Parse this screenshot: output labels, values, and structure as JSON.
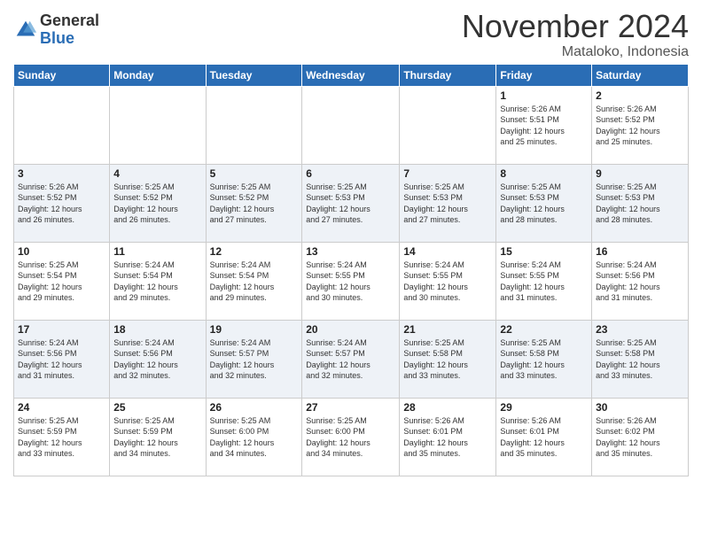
{
  "header": {
    "logo_general": "General",
    "logo_blue": "Blue",
    "month_title": "November 2024",
    "location": "Mataloko, Indonesia"
  },
  "weekdays": [
    "Sunday",
    "Monday",
    "Tuesday",
    "Wednesday",
    "Thursday",
    "Friday",
    "Saturday"
  ],
  "weeks": [
    [
      {
        "day": "",
        "info": ""
      },
      {
        "day": "",
        "info": ""
      },
      {
        "day": "",
        "info": ""
      },
      {
        "day": "",
        "info": ""
      },
      {
        "day": "",
        "info": ""
      },
      {
        "day": "1",
        "info": "Sunrise: 5:26 AM\nSunset: 5:51 PM\nDaylight: 12 hours\nand 25 minutes."
      },
      {
        "day": "2",
        "info": "Sunrise: 5:26 AM\nSunset: 5:52 PM\nDaylight: 12 hours\nand 25 minutes."
      }
    ],
    [
      {
        "day": "3",
        "info": "Sunrise: 5:26 AM\nSunset: 5:52 PM\nDaylight: 12 hours\nand 26 minutes."
      },
      {
        "day": "4",
        "info": "Sunrise: 5:25 AM\nSunset: 5:52 PM\nDaylight: 12 hours\nand 26 minutes."
      },
      {
        "day": "5",
        "info": "Sunrise: 5:25 AM\nSunset: 5:52 PM\nDaylight: 12 hours\nand 27 minutes."
      },
      {
        "day": "6",
        "info": "Sunrise: 5:25 AM\nSunset: 5:53 PM\nDaylight: 12 hours\nand 27 minutes."
      },
      {
        "day": "7",
        "info": "Sunrise: 5:25 AM\nSunset: 5:53 PM\nDaylight: 12 hours\nand 27 minutes."
      },
      {
        "day": "8",
        "info": "Sunrise: 5:25 AM\nSunset: 5:53 PM\nDaylight: 12 hours\nand 28 minutes."
      },
      {
        "day": "9",
        "info": "Sunrise: 5:25 AM\nSunset: 5:53 PM\nDaylight: 12 hours\nand 28 minutes."
      }
    ],
    [
      {
        "day": "10",
        "info": "Sunrise: 5:25 AM\nSunset: 5:54 PM\nDaylight: 12 hours\nand 29 minutes."
      },
      {
        "day": "11",
        "info": "Sunrise: 5:24 AM\nSunset: 5:54 PM\nDaylight: 12 hours\nand 29 minutes."
      },
      {
        "day": "12",
        "info": "Sunrise: 5:24 AM\nSunset: 5:54 PM\nDaylight: 12 hours\nand 29 minutes."
      },
      {
        "day": "13",
        "info": "Sunrise: 5:24 AM\nSunset: 5:55 PM\nDaylight: 12 hours\nand 30 minutes."
      },
      {
        "day": "14",
        "info": "Sunrise: 5:24 AM\nSunset: 5:55 PM\nDaylight: 12 hours\nand 30 minutes."
      },
      {
        "day": "15",
        "info": "Sunrise: 5:24 AM\nSunset: 5:55 PM\nDaylight: 12 hours\nand 31 minutes."
      },
      {
        "day": "16",
        "info": "Sunrise: 5:24 AM\nSunset: 5:56 PM\nDaylight: 12 hours\nand 31 minutes."
      }
    ],
    [
      {
        "day": "17",
        "info": "Sunrise: 5:24 AM\nSunset: 5:56 PM\nDaylight: 12 hours\nand 31 minutes."
      },
      {
        "day": "18",
        "info": "Sunrise: 5:24 AM\nSunset: 5:56 PM\nDaylight: 12 hours\nand 32 minutes."
      },
      {
        "day": "19",
        "info": "Sunrise: 5:24 AM\nSunset: 5:57 PM\nDaylight: 12 hours\nand 32 minutes."
      },
      {
        "day": "20",
        "info": "Sunrise: 5:24 AM\nSunset: 5:57 PM\nDaylight: 12 hours\nand 32 minutes."
      },
      {
        "day": "21",
        "info": "Sunrise: 5:25 AM\nSunset: 5:58 PM\nDaylight: 12 hours\nand 33 minutes."
      },
      {
        "day": "22",
        "info": "Sunrise: 5:25 AM\nSunset: 5:58 PM\nDaylight: 12 hours\nand 33 minutes."
      },
      {
        "day": "23",
        "info": "Sunrise: 5:25 AM\nSunset: 5:58 PM\nDaylight: 12 hours\nand 33 minutes."
      }
    ],
    [
      {
        "day": "24",
        "info": "Sunrise: 5:25 AM\nSunset: 5:59 PM\nDaylight: 12 hours\nand 33 minutes."
      },
      {
        "day": "25",
        "info": "Sunrise: 5:25 AM\nSunset: 5:59 PM\nDaylight: 12 hours\nand 34 minutes."
      },
      {
        "day": "26",
        "info": "Sunrise: 5:25 AM\nSunset: 6:00 PM\nDaylight: 12 hours\nand 34 minutes."
      },
      {
        "day": "27",
        "info": "Sunrise: 5:25 AM\nSunset: 6:00 PM\nDaylight: 12 hours\nand 34 minutes."
      },
      {
        "day": "28",
        "info": "Sunrise: 5:26 AM\nSunset: 6:01 PM\nDaylight: 12 hours\nand 35 minutes."
      },
      {
        "day": "29",
        "info": "Sunrise: 5:26 AM\nSunset: 6:01 PM\nDaylight: 12 hours\nand 35 minutes."
      },
      {
        "day": "30",
        "info": "Sunrise: 5:26 AM\nSunset: 6:02 PM\nDaylight: 12 hours\nand 35 minutes."
      }
    ]
  ]
}
